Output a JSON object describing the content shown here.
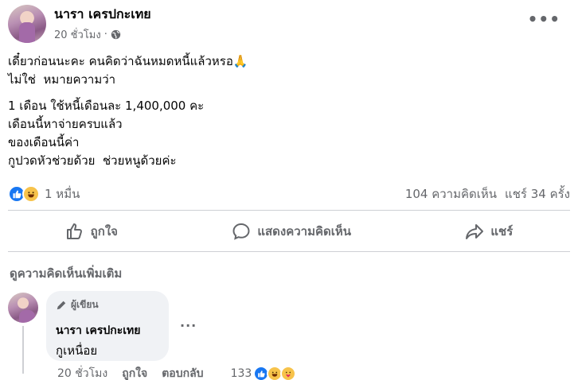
{
  "post": {
    "author": "นารา เครปกะเทย",
    "time": "20 ชั่วโมง",
    "separator": "·",
    "privacy_icon": "globe-icon",
    "lines": [
      "เดี๋ยวก่อนนะคะ คนคิดว่าฉันหมดหนี้แล้วหรอ🙏",
      "ไม่ใช่  หมายความว่า",
      "1 เดือน ใช้หนี้เดือนละ 1,400,000 คะ",
      "เดือนนี้หาจ่ายครบแล้ว",
      "ของเดือนนี้ค่า",
      "กูปวดหัวช่วยด้วย  ช่วยหนูด้วยค่ะ"
    ],
    "reactions_count": "1 หมื่น",
    "comments_count": "104 ความคิดเห็น",
    "shares_count": "แชร์ 34 ครั้ง"
  },
  "actions": {
    "like": "ถูกใจ",
    "comment": "แสดงความคิดเห็น",
    "share": "แชร์"
  },
  "comments_section": {
    "more_comments": "ดูความคิดเห็นเพิ่มเติม",
    "comment": {
      "badge": "ผู้เขียน",
      "author": "นารา เครปกะเทย",
      "text": "กูเหนื่อย",
      "time": "20 ชั่วโมง",
      "like_label": "ถูกใจ",
      "reply_label": "ตอบกลับ",
      "reactions_count": "133"
    }
  },
  "colors": {
    "like_blue": "#1877f2",
    "secondary_text": "#65676b",
    "bubble_bg": "#f0f2f5"
  }
}
